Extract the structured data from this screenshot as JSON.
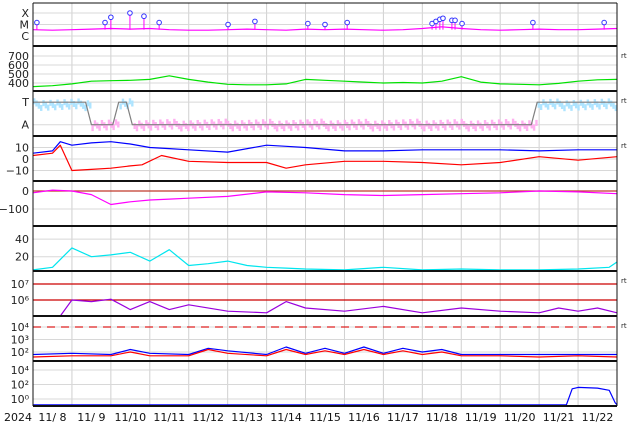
{
  "chart_data": {
    "type": "line",
    "title": "",
    "x_axis": {
      "start_label": "2024",
      "unit": "days since 11/7 00:00",
      "range": [
        0,
        15
      ],
      "tick_labels": [
        "11/ 8",
        "11/ 9",
        "11/10",
        "11/11",
        "11/12",
        "11/13",
        "11/14",
        "11/15",
        "11/16",
        "11/17",
        "11/18",
        "11/19",
        "11/20",
        "11/21",
        "11/22"
      ]
    },
    "grid": true,
    "panels": [
      {
        "id": "xray",
        "scale": "log10 flux",
        "ticks": [
          {
            "v": -4,
            "label": "X"
          },
          {
            "v": -5,
            "label": "M"
          },
          {
            "v": -6,
            "label": "C"
          }
        ],
        "series": [
          {
            "name": "xray-flux",
            "color": "#ff00ff",
            "x": [
              0,
              0.5,
              1,
              1.5,
              2,
              2.5,
              3,
              3.5,
              4,
              4.5,
              5,
              5.5,
              6,
              6.5,
              7,
              7.5,
              8,
              8.5,
              9,
              9.5,
              10,
              10.5,
              11,
              11.5,
              12,
              12.5,
              13,
              13.5,
              14,
              14.5,
              15
            ],
            "y": [
              -5.45,
              -5.5,
              -5.45,
              -5.4,
              -5.35,
              -5.4,
              -5.35,
              -5.45,
              -5.5,
              -5.5,
              -5.45,
              -5.4,
              -5.45,
              -5.5,
              -5.4,
              -5.45,
              -5.4,
              -5.45,
              -5.5,
              -5.45,
              -5.35,
              -5.2,
              -5.35,
              -5.45,
              -5.5,
              -5.45,
              -5.4,
              -5.45,
              -5.45,
              -5.4,
              -5.35
            ]
          }
        ],
        "flares": [
          {
            "day": 0.1,
            "log": -4.83,
            "class": "M1.5"
          },
          {
            "day": 1.85,
            "log": -4.83,
            "class": "M1.5"
          },
          {
            "day": 2.0,
            "log": -4.37,
            "class": "M4.3"
          },
          {
            "day": 2.49,
            "log": -4.0,
            "class": "X1.0"
          },
          {
            "day": 2.85,
            "log": -4.28,
            "class": "M5.3"
          },
          {
            "day": 3.24,
            "log": -4.83,
            "class": "M1.5"
          },
          {
            "day": 5.01,
            "log": -5.0,
            "class": "M1.0"
          },
          {
            "day": 5.7,
            "log": -4.73,
            "class": "M1.9"
          },
          {
            "day": 7.06,
            "log": -4.92,
            "class": "M1.2"
          },
          {
            "day": 7.5,
            "log": -5.0,
            "class": "M1.0"
          },
          {
            "day": 8.07,
            "log": -4.83,
            "class": "M1.5"
          },
          {
            "day": 10.25,
            "log": -4.92,
            "class": "M1.2"
          },
          {
            "day": 10.35,
            "log": -4.73,
            "class": "M1.9"
          },
          {
            "day": 10.45,
            "log": -4.55,
            "class": "M2.8"
          },
          {
            "day": 10.53,
            "log": -4.46,
            "class": "M3.5"
          },
          {
            "day": 10.76,
            "log": -4.64,
            "class": "M2.3"
          },
          {
            "day": 10.84,
            "log": -4.64,
            "class": "M2.3"
          },
          {
            "day": 11.02,
            "log": -4.92,
            "class": "M1.2"
          },
          {
            "day": 12.84,
            "log": -4.83,
            "class": "M1.5"
          },
          {
            "day": 14.67,
            "log": -4.83,
            "class": "M1.5"
          }
        ]
      },
      {
        "id": "solar-wind-speed",
        "rt": "rt",
        "ticks": [
          {
            "v": 700,
            "label": "700"
          },
          {
            "v": 600,
            "label": "600"
          },
          {
            "v": 500,
            "label": "500"
          },
          {
            "v": 400,
            "label": "400"
          }
        ],
        "series": [
          {
            "name": "speed",
            "color": "#00e000",
            "x": [
              0,
              0.5,
              1,
              1.5,
              2,
              2.5,
              3,
              3.5,
              4,
              4.5,
              5,
              5.5,
              6,
              6.5,
              7,
              7.5,
              8,
              8.5,
              9,
              9.5,
              10,
              10.5,
              11,
              11.5,
              12,
              12.5,
              13,
              13.5,
              14,
              14.5,
              15
            ],
            "y": [
              360,
              370,
              390,
              420,
              425,
              430,
              440,
              480,
              440,
              410,
              385,
              380,
              380,
              390,
              440,
              430,
              420,
              410,
              400,
              405,
              400,
              420,
              470,
              410,
              390,
              385,
              380,
              395,
              420,
              435,
              440
            ]
          }
        ]
      },
      {
        "id": "imf-sector",
        "rt": "rt",
        "ticks": [
          {
            "v": 1,
            "label": "T"
          },
          {
            "v": 0,
            "label": "A"
          }
        ],
        "series": [
          {
            "name": "sector-polarity",
            "color": "#808080",
            "x": [
              0,
              1.35,
              1.5,
              2.05,
              2.2,
              2.4,
              2.55,
              12.8,
              12.95,
              15
            ],
            "y": [
              1,
              1,
              0,
              0,
              1,
              1,
              0,
              0,
              1,
              1
            ]
          }
        ],
        "colors": {
          "toward": "#aee4ff",
          "away": "#ffb0f0",
          "line_toward": "#6a8cff",
          "line_away": "#c0392b"
        }
      },
      {
        "id": "imf-bt-bz",
        "rt": "rt",
        "ticks": [
          {
            "v": 10,
            "label": "10"
          },
          {
            "v": 0,
            "label": "0"
          },
          {
            "v": -10,
            "label": "−10"
          }
        ],
        "series": [
          {
            "name": "Bt",
            "color": "#0000ff",
            "x": [
              0,
              0.5,
              0.7,
              1,
              1.5,
              2,
              2.5,
              3,
              3.5,
              4,
              5,
              6,
              6.5,
              7,
              8,
              9,
              10,
              11,
              12,
              13,
              14,
              15
            ],
            "y": [
              5,
              7,
              15,
              12,
              14,
              15,
              13,
              10,
              9,
              8,
              6,
              12,
              11,
              10,
              7,
              7,
              8,
              8,
              8,
              7,
              8,
              8
            ]
          },
          {
            "name": "Bz",
            "color": "#ff0000",
            "x": [
              0,
              0.5,
              0.7,
              1,
              1.5,
              2,
              2.5,
              2.8,
              3.3,
              4,
              5,
              6,
              6.5,
              7,
              8,
              9,
              10,
              11,
              12,
              13,
              14,
              15
            ],
            "y": [
              3,
              5,
              12,
              -10,
              -9,
              -8,
              -6,
              -5,
              3,
              -2,
              -3,
              -3,
              -8,
              -5,
              -2,
              -2,
              -3,
              -5,
              -3,
              2,
              -1,
              2
            ]
          }
        ]
      },
      {
        "id": "dst",
        "ticks": [
          {
            "v": 0,
            "label": "0"
          },
          {
            "v": -100,
            "label": "−100"
          }
        ],
        "series": [
          {
            "name": "Dst",
            "color": "#ff00ff",
            "x": [
              0,
              0.5,
              1,
              1.5,
              2,
              2.5,
              3,
              3.5,
              4,
              5,
              6,
              7,
              8,
              9,
              10,
              11,
              12,
              13,
              14,
              15
            ],
            "y": [
              -10,
              5,
              0,
              -20,
              -75,
              -60,
              -50,
              -45,
              -40,
              -30,
              -5,
              -10,
              -20,
              -25,
              -20,
              -15,
              -10,
              0,
              -5,
              -15
            ]
          }
        ],
        "ref_lines": [
          {
            "v": 0,
            "color": "#c0392b"
          }
        ]
      },
      {
        "id": "panel-6",
        "ticks": [
          {
            "v": 40,
            "label": "40"
          },
          {
            "v": 20,
            "label": "20"
          }
        ],
        "series": [
          {
            "name": "series-cyan",
            "color": "#00e5ee",
            "x": [
              0,
              0.5,
              1,
              1.5,
              2,
              2.5,
              3,
              3.5,
              4,
              4.5,
              5,
              5.5,
              6,
              6.5,
              7,
              8,
              9,
              10,
              11,
              12,
              13,
              14,
              14.8,
              15
            ],
            "y": [
              5,
              8,
              30,
              20,
              22,
              25,
              15,
              28,
              10,
              12,
              15,
              10,
              8,
              7,
              6,
              5,
              8,
              5,
              6,
              5,
              5,
              6,
              8,
              14
            ]
          }
        ]
      },
      {
        "id": "electron-flux",
        "rt": "rt",
        "ticks": [
          {
            "v": 7,
            "label": "10⁷"
          },
          {
            "v": 6,
            "label": "10⁶"
          }
        ],
        "series": [
          {
            "name": "series-purple",
            "color": "#9900dd",
            "x": [
              0.7,
              1,
              1.5,
              2,
              2.5,
              3,
              3.5,
              4,
              5,
              6,
              6.5,
              7,
              8,
              9,
              10,
              11,
              12,
              13,
              13.5,
              14,
              14.5,
              15
            ],
            "y": [
              5.0,
              6.0,
              5.9,
              6.05,
              5.4,
              5.9,
              5.4,
              5.7,
              5.3,
              5.2,
              5.9,
              5.5,
              5.3,
              5.6,
              5.2,
              5.5,
              5.3,
              5.2,
              5.5,
              5.3,
              5.5,
              5.2
            ]
          }
        ],
        "ref_lines": [
          {
            "v": 7,
            "color": "#cc0000"
          },
          {
            "v": 6,
            "color": "#cc0000"
          }
        ]
      },
      {
        "id": "proton-flux",
        "rt": "rt",
        "ticks": [
          {
            "v": 4,
            "label": "10⁴"
          },
          {
            "v": 3,
            "label": "10³"
          },
          {
            "v": 2,
            "label": "10²"
          }
        ],
        "series": [
          {
            "name": "series-blue",
            "color": "#0000ff",
            "x": [
              0,
              1,
              2,
              2.5,
              3,
              4,
              4.5,
              5,
              6,
              6.5,
              7,
              7.5,
              8,
              8.5,
              9,
              9.5,
              10,
              10.5,
              11,
              12,
              13,
              14,
              15
            ],
            "y": [
              1.8,
              1.9,
              1.8,
              2.2,
              1.9,
              1.8,
              2.3,
              2.1,
              1.8,
              2.4,
              1.9,
              2.3,
              1.9,
              2.4,
              1.9,
              2.3,
              2.0,
              2.2,
              1.8,
              1.8,
              1.8,
              1.8,
              1.8
            ]
          },
          {
            "name": "series-red",
            "color": "#ff0000",
            "x": [
              0,
              1,
              2,
              2.5,
              3,
              4,
              4.5,
              5,
              6,
              6.5,
              7,
              7.5,
              8,
              8.5,
              9,
              9.5,
              10,
              10.5,
              11,
              12,
              13,
              14,
              15
            ],
            "y": [
              1.6,
              1.7,
              1.7,
              2.0,
              1.7,
              1.7,
              2.2,
              1.9,
              1.7,
              2.2,
              1.8,
              2.1,
              1.8,
              2.2,
              1.8,
              2.1,
              1.8,
              2.0,
              1.7,
              1.7,
              1.6,
              1.7,
              1.6
            ]
          }
        ],
        "ref_lines": [
          {
            "v": 4,
            "color": "#dd2222",
            "dashed": true
          }
        ]
      },
      {
        "id": "high-energy-proton",
        "ticks": [
          {
            "v": 4,
            "label": "10⁴"
          },
          {
            "v": 2,
            "label": "10²"
          },
          {
            "v": 0,
            "label": "10⁰"
          }
        ],
        "series": [
          {
            "name": "series-blue-low",
            "color": "#0000ff",
            "x": [
              0,
              13.7,
              13.85,
              14.0,
              14.5,
              14.8,
              14.95,
              15
            ],
            "y": [
              -0.8,
              -0.8,
              1.4,
              1.6,
              1.5,
              1.2,
              -0.5,
              -0.8
            ]
          }
        ]
      }
    ]
  }
}
